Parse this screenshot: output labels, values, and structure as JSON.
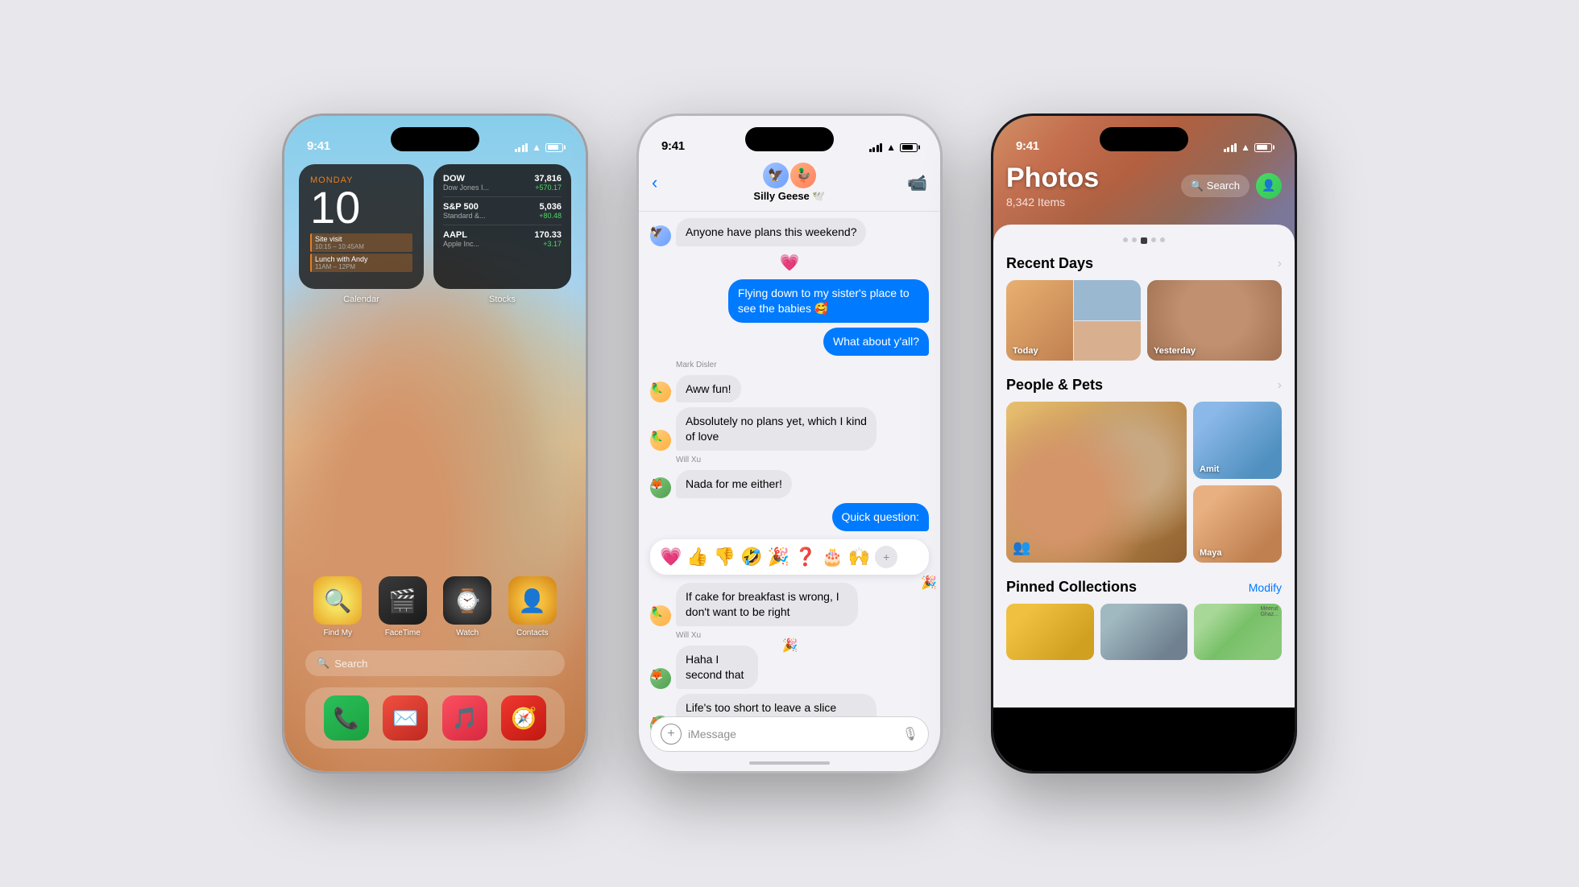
{
  "bg_color": "#e8e8ec",
  "phones": [
    {
      "id": "phone1",
      "type": "home_screen",
      "time": "9:41",
      "calendar_widget": {
        "day": "MONDAY",
        "date": "10",
        "events": [
          {
            "title": "Site visit",
            "time": "10:15 – 10:45AM"
          },
          {
            "title": "Lunch with Andy",
            "time": "11AM – 12PM"
          }
        ]
      },
      "stocks_widget": {
        "items": [
          {
            "name": "DOW",
            "sub": "Dow Jones I...",
            "price": "37,816",
            "change": "+570.17"
          },
          {
            "name": "S&P 500",
            "sub": "Standard &...",
            "price": "5,036",
            "change": "+80.48"
          },
          {
            "name": "AAPL",
            "sub": "Apple Inc...",
            "price": "170.33",
            "change": "+3.17"
          }
        ]
      },
      "widget_labels": [
        "Calendar",
        "Stocks"
      ],
      "apps_row1": [
        {
          "icon": "🔍",
          "label": "Find My",
          "color": "#f0a030"
        },
        {
          "icon": "🎬",
          "label": "FaceTime",
          "color": "#2d2d2d"
        },
        {
          "icon": "⌚",
          "label": "Watch",
          "color": "#2d2d2d"
        },
        {
          "icon": "👤",
          "label": "Contacts",
          "color": "#f0a030"
        }
      ],
      "search_label": "🔍 Search",
      "dock_apps": [
        {
          "icon": "📞",
          "color": "#2ac05a"
        },
        {
          "icon": "✉️",
          "color": "#e74c3c"
        },
        {
          "icon": "🎵",
          "color": "#fc3c44"
        },
        {
          "icon": "🧭",
          "color": "#f03c2a"
        }
      ]
    },
    {
      "id": "phone2",
      "type": "messages",
      "time": "9:41",
      "group_name": "Silly Geese 🕊️",
      "messages": [
        {
          "type": "received",
          "text": "Anyone have plans this weekend?",
          "sender": null
        },
        {
          "type": "heart",
          "text": "💗"
        },
        {
          "type": "sent",
          "text": "Flying down to my sister's place to see the babies 🥰"
        },
        {
          "type": "sent",
          "text": "What about y'all?"
        },
        {
          "type": "sender_label",
          "text": "Mark Disler"
        },
        {
          "type": "received",
          "text": "Aww fun!"
        },
        {
          "type": "received",
          "text": "Absolutely no plans yet, which I kind of love"
        },
        {
          "type": "sender_label",
          "text": "Will Xu"
        },
        {
          "type": "received",
          "text": "Nada for me either!"
        },
        {
          "type": "sent",
          "text": "Quick question:"
        },
        {
          "type": "reactions",
          "emojis": [
            "💗",
            "👍",
            "👎",
            "🤣",
            "🎉",
            "❓",
            "🎂",
            "🙌"
          ]
        },
        {
          "type": "received",
          "text": "If cake for breakfast is wrong, I don't want to be right",
          "tapback": "🎉"
        },
        {
          "type": "sender_label2",
          "text": "Will Xu"
        },
        {
          "type": "received2",
          "text": "Haha I second that",
          "tapback": "🎉"
        },
        {
          "type": "received3",
          "text": "Life's too short to leave a slice behind"
        }
      ],
      "input_placeholder": "iMessage"
    },
    {
      "id": "phone3",
      "type": "photos",
      "time": "9:41",
      "title": "Photos",
      "count": "8,342 Items",
      "search_label": "🔍 Search",
      "sections": {
        "recent_days": {
          "title": "Recent Days",
          "days": [
            "Today",
            "Yesterday"
          ]
        },
        "people_pets": {
          "title": "People & Pets",
          "people": [
            "Amit",
            "Maya"
          ]
        },
        "pinned": {
          "title": "Pinned Collections",
          "modify": "Modify"
        }
      }
    }
  ]
}
